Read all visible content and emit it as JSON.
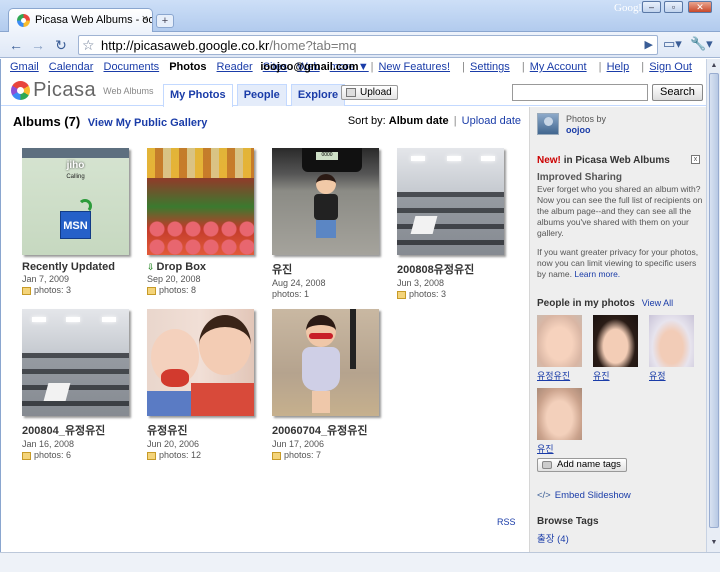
{
  "browser": {
    "tab_title": "Picasa Web Albums - oo...",
    "tab_close": "×",
    "new_tab": "+",
    "google": "Google",
    "url_host": "http://picasaweb.google.co.kr",
    "url_path": "/home?tab=mq",
    "win_min": "–",
    "win_max": "▫",
    "win_close": "✕"
  },
  "gbar": {
    "left": [
      "Gmail",
      "Calendar",
      "Documents",
      "Photos",
      "Reader",
      "Sites",
      "Web",
      "more ▼"
    ],
    "email": "ioojoo@gmail.com",
    "sep": "|",
    "right": [
      "New Features!",
      "Settings",
      "My Account",
      "Help",
      "Sign Out"
    ]
  },
  "header": {
    "logo_text": "Picasa",
    "logo_sub": "Web Albums",
    "tabs": [
      "My Photos",
      "People",
      "Explore"
    ],
    "upload": "Upload",
    "search_button": "Search"
  },
  "albums": {
    "title": "Albums (7)",
    "public_gallery": "View My Public Gallery",
    "sort_label": "Sort by:",
    "sort_current": "Album date",
    "sort_sep": "|",
    "sort_other": "Upload date",
    "thumb_text": {
      "jiho": "jiho",
      "calling": "Calling",
      "msn": "MSN",
      "plate": "0000"
    },
    "items": [
      {
        "name": "Recently Updated",
        "date": "Jan 7, 2009",
        "count": "photos: 3"
      },
      {
        "name": "Drop Box",
        "date": "Sep 20, 2008",
        "count": "photos: 8"
      },
      {
        "name": "유진",
        "date": "Aug 24, 2008",
        "count": "photos: 1"
      },
      {
        "name": "200808유정유진",
        "date": "Jun 3, 2008",
        "count": "photos: 3"
      },
      {
        "name": "200804_유정유진",
        "date": "Jan 16, 2008",
        "count": "photos: 6"
      },
      {
        "name": "유정유진",
        "date": "Jun 20, 2006",
        "count": "photos: 12"
      },
      {
        "name": "20060704_유정유진",
        "date": "Jun 17, 2006",
        "count": "photos: 7"
      }
    ],
    "rss": "RSS"
  },
  "sidebar": {
    "photos_by": "Photos by",
    "user": "oojoo",
    "promo_new": "New!",
    "promo_title": "in Picasa Web Albums",
    "promo_close": "x",
    "promo_subtitle": "Improved Sharing",
    "promo_text": "Ever forget who you shared an album with? Now you can see the full list of recipients on the album page--and they can see all the albums you've shared with them on your gallery.",
    "promo_text2": "If you want greater privacy for your photos, now you can limit viewing to specific users by name.",
    "learn_more": "Learn more.",
    "people_title": "People in my photos",
    "view_all": "View All",
    "people": [
      "유정유진",
      "유진",
      "유정",
      "유진"
    ],
    "add_tags": "Add name tags",
    "slideshow": "Embed Slideshow",
    "browse_tags": "Browse Tags",
    "tag": "출장 (4)"
  }
}
